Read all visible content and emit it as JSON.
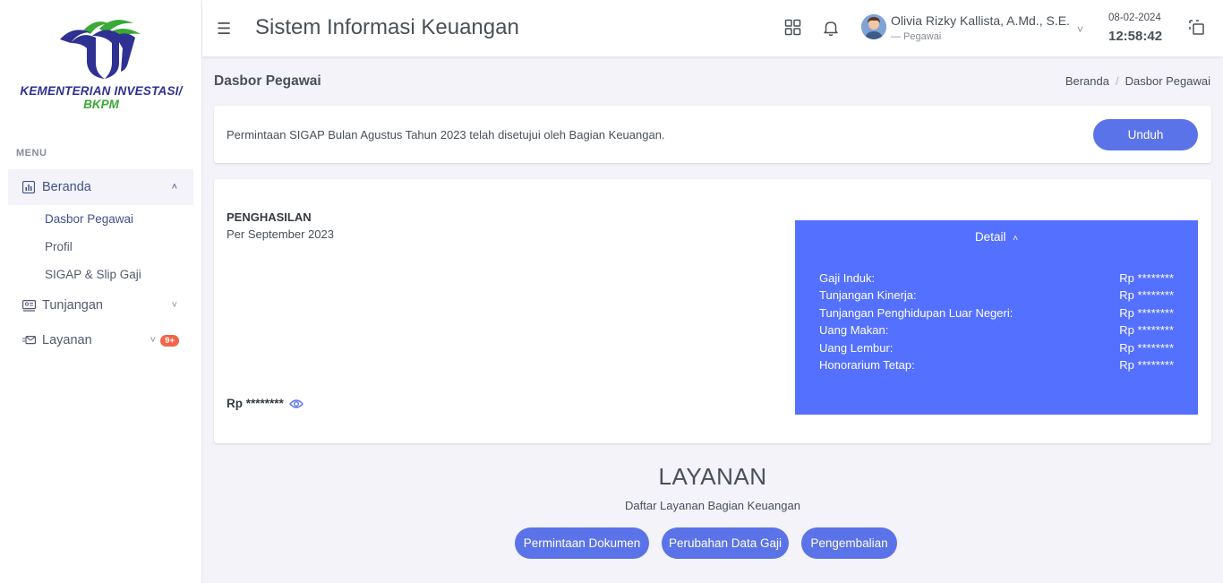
{
  "sidebar": {
    "logo_line1": "KEMENTERIAN INVESTASI/",
    "logo_line2": "BKPM",
    "menu_title": "MENU",
    "items": [
      {
        "label": "Beranda",
        "icon": "chart-icon"
      },
      {
        "label": "Tunjangan",
        "icon": "id-card-icon"
      },
      {
        "label": "Layanan",
        "icon": "envelope-icon",
        "badge": "9+"
      }
    ],
    "sub_items": [
      "Dasbor Pegawai",
      "Profil",
      "SIGAP & Slip Gaji"
    ]
  },
  "header": {
    "title": "Sistem Informasi Keuangan",
    "user_name": "Olivia Rizky Kallista, A.Md., S.E.",
    "user_role": "— Pegawai",
    "date": "08-02-2024",
    "time": "12:58:42"
  },
  "page": {
    "title": "Dasbor Pegawai",
    "breadcrumb": [
      "Beranda",
      "Dasbor Pegawai"
    ]
  },
  "notice": {
    "text": "Permintaan SIGAP Bulan Agustus Tahun 2023 telah disetujui oleh Bagian Keuangan.",
    "button": "Unduh"
  },
  "income": {
    "title": "PENGHASILAN",
    "subtitle": "Per September 2023",
    "amount": "Rp ********",
    "detail_label": "Detail",
    "rows": [
      {
        "label": "Gaji Induk:",
        "value": "Rp ********"
      },
      {
        "label": "Tunjangan Kinerja:",
        "value": "Rp ********"
      },
      {
        "label": "Tunjangan Penghidupan Luar Negeri:",
        "value": "Rp ********"
      },
      {
        "label": "Uang Makan:",
        "value": "Rp ********"
      },
      {
        "label": "Uang Lembur:",
        "value": "Rp ********"
      },
      {
        "label": "Honorarium Tetap:",
        "value": "Rp ********"
      }
    ]
  },
  "layanan": {
    "title": "LAYANAN",
    "subtitle": "Daftar Layanan Bagian Keuangan",
    "buttons": [
      "Permintaan Dokumen",
      "Perubahan Data Gaji",
      "Pengembalian"
    ]
  },
  "colors": {
    "primary": "#5b73e8",
    "detail_bg": "#5470ff",
    "active_nav": "#405189",
    "badge": "#f06548",
    "logo_blue": "#2e3192",
    "logo_green": "#3aa935"
  }
}
